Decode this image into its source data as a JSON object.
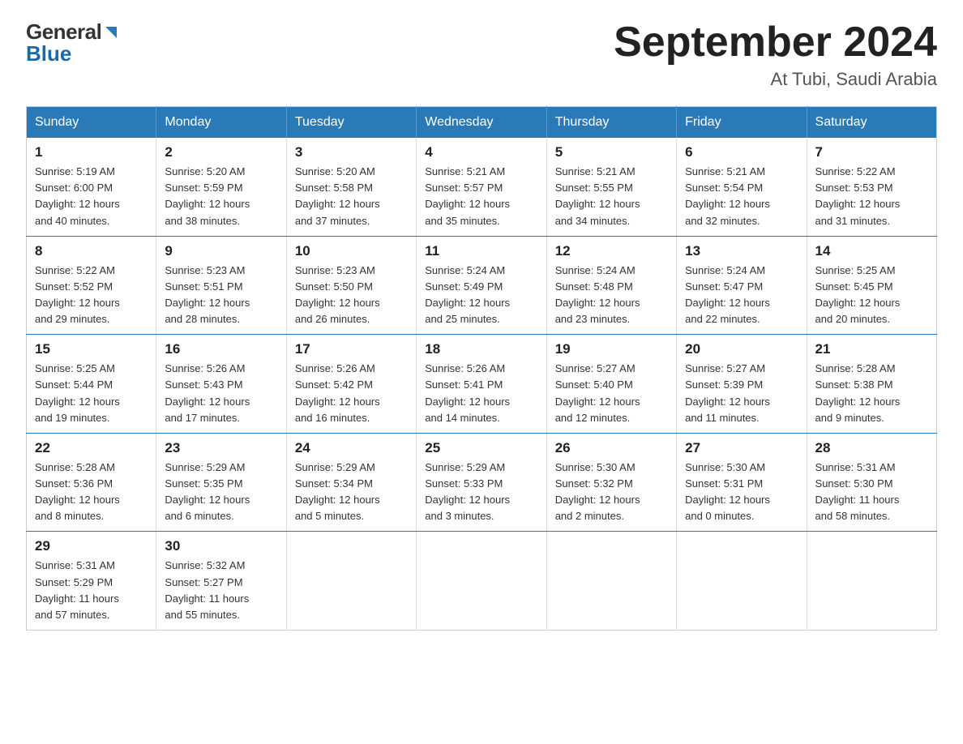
{
  "header": {
    "logo_general": "General",
    "logo_blue": "Blue",
    "month_title": "September 2024",
    "location": "At Tubi, Saudi Arabia"
  },
  "calendar": {
    "days_of_week": [
      "Sunday",
      "Monday",
      "Tuesday",
      "Wednesday",
      "Thursday",
      "Friday",
      "Saturday"
    ],
    "weeks": [
      [
        {
          "day": "1",
          "sunrise": "5:19 AM",
          "sunset": "6:00 PM",
          "daylight": "12 hours and 40 minutes."
        },
        {
          "day": "2",
          "sunrise": "5:20 AM",
          "sunset": "5:59 PM",
          "daylight": "12 hours and 38 minutes."
        },
        {
          "day": "3",
          "sunrise": "5:20 AM",
          "sunset": "5:58 PM",
          "daylight": "12 hours and 37 minutes."
        },
        {
          "day": "4",
          "sunrise": "5:21 AM",
          "sunset": "5:57 PM",
          "daylight": "12 hours and 35 minutes."
        },
        {
          "day": "5",
          "sunrise": "5:21 AM",
          "sunset": "5:55 PM",
          "daylight": "12 hours and 34 minutes."
        },
        {
          "day": "6",
          "sunrise": "5:21 AM",
          "sunset": "5:54 PM",
          "daylight": "12 hours and 32 minutes."
        },
        {
          "day": "7",
          "sunrise": "5:22 AM",
          "sunset": "5:53 PM",
          "daylight": "12 hours and 31 minutes."
        }
      ],
      [
        {
          "day": "8",
          "sunrise": "5:22 AM",
          "sunset": "5:52 PM",
          "daylight": "12 hours and 29 minutes."
        },
        {
          "day": "9",
          "sunrise": "5:23 AM",
          "sunset": "5:51 PM",
          "daylight": "12 hours and 28 minutes."
        },
        {
          "day": "10",
          "sunrise": "5:23 AM",
          "sunset": "5:50 PM",
          "daylight": "12 hours and 26 minutes."
        },
        {
          "day": "11",
          "sunrise": "5:24 AM",
          "sunset": "5:49 PM",
          "daylight": "12 hours and 25 minutes."
        },
        {
          "day": "12",
          "sunrise": "5:24 AM",
          "sunset": "5:48 PM",
          "daylight": "12 hours and 23 minutes."
        },
        {
          "day": "13",
          "sunrise": "5:24 AM",
          "sunset": "5:47 PM",
          "daylight": "12 hours and 22 minutes."
        },
        {
          "day": "14",
          "sunrise": "5:25 AM",
          "sunset": "5:45 PM",
          "daylight": "12 hours and 20 minutes."
        }
      ],
      [
        {
          "day": "15",
          "sunrise": "5:25 AM",
          "sunset": "5:44 PM",
          "daylight": "12 hours and 19 minutes."
        },
        {
          "day": "16",
          "sunrise": "5:26 AM",
          "sunset": "5:43 PM",
          "daylight": "12 hours and 17 minutes."
        },
        {
          "day": "17",
          "sunrise": "5:26 AM",
          "sunset": "5:42 PM",
          "daylight": "12 hours and 16 minutes."
        },
        {
          "day": "18",
          "sunrise": "5:26 AM",
          "sunset": "5:41 PM",
          "daylight": "12 hours and 14 minutes."
        },
        {
          "day": "19",
          "sunrise": "5:27 AM",
          "sunset": "5:40 PM",
          "daylight": "12 hours and 12 minutes."
        },
        {
          "day": "20",
          "sunrise": "5:27 AM",
          "sunset": "5:39 PM",
          "daylight": "12 hours and 11 minutes."
        },
        {
          "day": "21",
          "sunrise": "5:28 AM",
          "sunset": "5:38 PM",
          "daylight": "12 hours and 9 minutes."
        }
      ],
      [
        {
          "day": "22",
          "sunrise": "5:28 AM",
          "sunset": "5:36 PM",
          "daylight": "12 hours and 8 minutes."
        },
        {
          "day": "23",
          "sunrise": "5:29 AM",
          "sunset": "5:35 PM",
          "daylight": "12 hours and 6 minutes."
        },
        {
          "day": "24",
          "sunrise": "5:29 AM",
          "sunset": "5:34 PM",
          "daylight": "12 hours and 5 minutes."
        },
        {
          "day": "25",
          "sunrise": "5:29 AM",
          "sunset": "5:33 PM",
          "daylight": "12 hours and 3 minutes."
        },
        {
          "day": "26",
          "sunrise": "5:30 AM",
          "sunset": "5:32 PM",
          "daylight": "12 hours and 2 minutes."
        },
        {
          "day": "27",
          "sunrise": "5:30 AM",
          "sunset": "5:31 PM",
          "daylight": "12 hours and 0 minutes."
        },
        {
          "day": "28",
          "sunrise": "5:31 AM",
          "sunset": "5:30 PM",
          "daylight": "11 hours and 58 minutes."
        }
      ],
      [
        {
          "day": "29",
          "sunrise": "5:31 AM",
          "sunset": "5:29 PM",
          "daylight": "11 hours and 57 minutes."
        },
        {
          "day": "30",
          "sunrise": "5:32 AM",
          "sunset": "5:27 PM",
          "daylight": "11 hours and 55 minutes."
        },
        null,
        null,
        null,
        null,
        null
      ]
    ],
    "labels": {
      "sunrise": "Sunrise:",
      "sunset": "Sunset:",
      "daylight": "Daylight:"
    }
  }
}
